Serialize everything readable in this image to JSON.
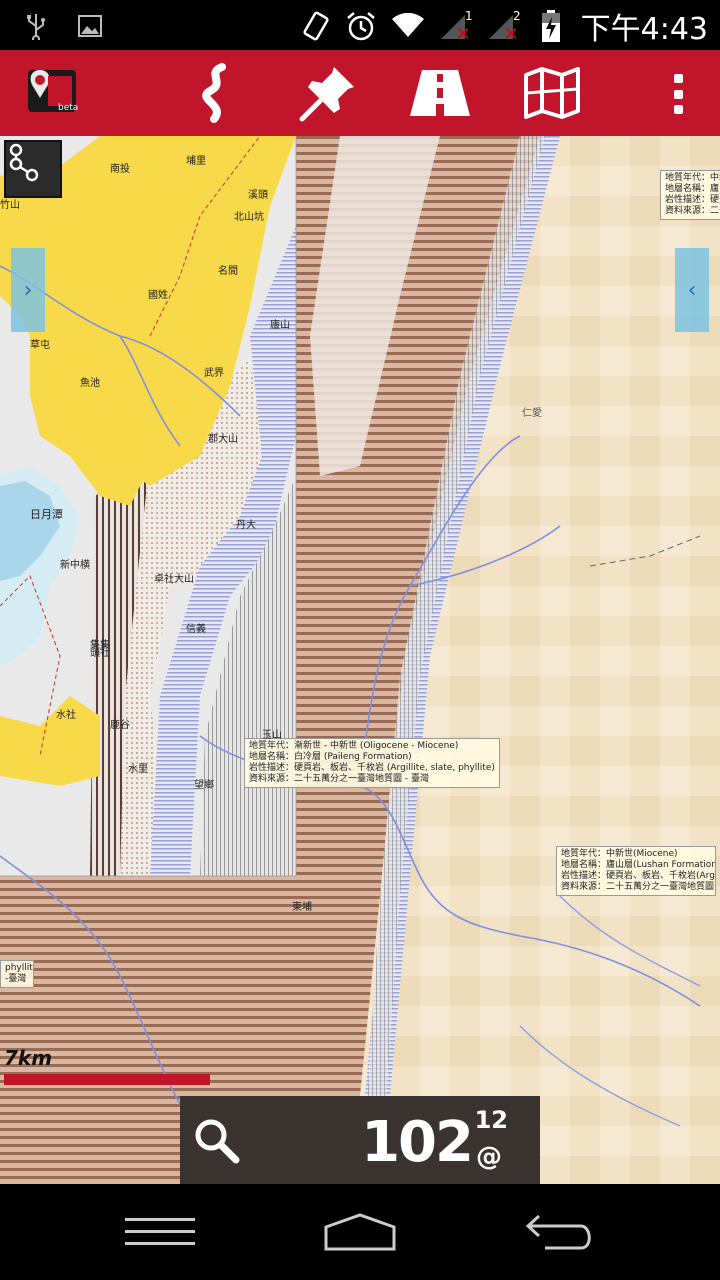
{
  "status_bar": {
    "time": "下午4:43",
    "sim1_label": "1",
    "sim2_label": "2",
    "icons": [
      "usb-icon",
      "image-icon",
      "vibrate-icon",
      "alarm-icon",
      "wifi-icon",
      "signal-icon",
      "battery-icon"
    ]
  },
  "toolbar": {
    "logo_text": "beta",
    "buttons": [
      "route-icon",
      "pin-icon",
      "road-icon",
      "map-icon",
      "overflow-menu-icon"
    ],
    "bg_color": "#c0152b"
  },
  "map": {
    "scale_label": "7km",
    "zoom_level": "102",
    "zoom_sup": "12",
    "zoom_at": "@",
    "labels": {
      "box1": [
        "地質年代：漸新世 - 中新世 (Oligocene - Miocene)",
        "地層名稱：白冷層 (Paileng Formation)",
        "岩性描述：硬頁岩、板岩、千枚岩 (Argillite, slate, phyllite)",
        "資料來源：二十五萬分之一臺灣地質圖 - 臺灣"
      ],
      "box2": [
        "地質年代：中新世(Miocene)",
        "地層名稱：廬山層(Lushan Formation)",
        "岩性描述：硬頁岩、板岩、千枚岩(Argillite, s",
        "資料來源：二十五萬分之一臺灣地質圖 - 臺"
      ],
      "box3": [
        "地質年代：中新",
        "地層名稱：廬山",
        "岩性描述：硬頁",
        "資料來源：二十"
      ],
      "box4": [
        "phyllite)",
        "-臺灣"
      ],
      "places": [
        "日月潭",
        "魚池",
        "埔里",
        "水里",
        "集集",
        "信義",
        "東埔",
        "玉山",
        "郡大山",
        "望鄉",
        "卓社大山",
        "丹大",
        "北山坑",
        "草屯",
        "國姓",
        "仁愛",
        "新中横",
        "廬山",
        "武界",
        "水社",
        "頭社",
        "南投",
        "竹山",
        "鹿谷",
        "溪頭",
        "名間"
      ]
    }
  },
  "nav": {
    "buttons": [
      "recent-apps-icon",
      "home-icon",
      "back-icon"
    ]
  }
}
